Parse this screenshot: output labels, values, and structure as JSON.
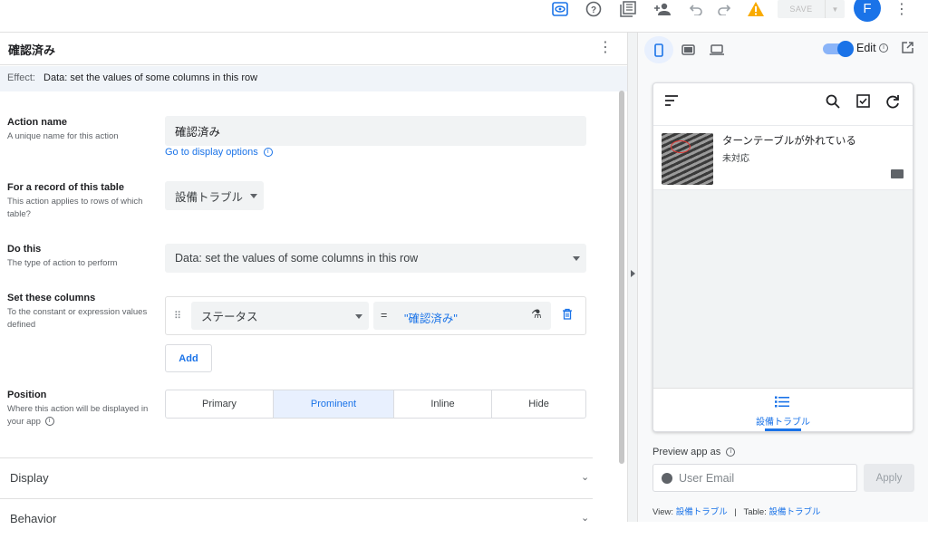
{
  "toolbar": {
    "icons": [
      "eye-icon",
      "help-icon",
      "gallery-icon",
      "add-person-icon",
      "undo-icon",
      "redo-icon",
      "warning-icon"
    ],
    "save_label": "SAVE",
    "avatar_letter": "F",
    "colors": {
      "accent": "#1a73e8",
      "warning": "#f9ab00"
    }
  },
  "action": {
    "header_title": "確認済み",
    "effect_key": "Effect:",
    "effect_value": "Data: set the values of some columns in this row"
  },
  "fields": {
    "action_name": {
      "title": "Action name",
      "desc": "A unique name for this action",
      "value": "確認済み",
      "link": "Go to display options"
    },
    "table": {
      "title": "For a record of this table",
      "desc": "This action applies to rows of which table?",
      "value": "設備トラブル"
    },
    "do_this": {
      "title": "Do this",
      "desc": "The type of action to perform",
      "value": "Data: set the values of some columns in this row"
    },
    "set_columns": {
      "title": "Set these columns",
      "desc": "To the constant or expression values defined",
      "column": "ステータス",
      "operator": "=",
      "expression": "\"確認済み\"",
      "add_label": "Add"
    },
    "position": {
      "title": "Position",
      "desc": "Where this action will be displayed in your app",
      "options": [
        "Primary",
        "Prominent",
        "Inline",
        "Hide"
      ],
      "selected": "Prominent"
    }
  },
  "sections": [
    "Display",
    "Behavior"
  ],
  "preview": {
    "edit_label": "Edit",
    "edit_on": true,
    "item_title": "ターンテーブルが外れている",
    "item_sub": "未対応",
    "nav_label": "設備トラブル",
    "preview_as_label": "Preview app as",
    "email_placeholder": "User Email",
    "apply_label": "Apply",
    "footer_view_label": "View:",
    "footer_view_value": "設備トラブル",
    "footer_sep": "|",
    "footer_table_label": "Table:",
    "footer_table_value": "設備トラブル"
  }
}
